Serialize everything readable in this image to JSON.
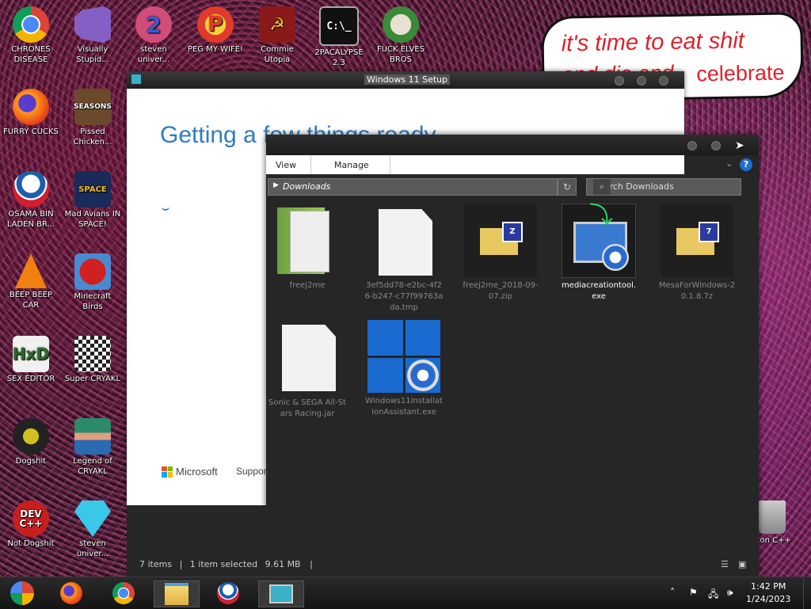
{
  "desktop": {
    "icons": [
      {
        "label": "CHRONES DISEASE",
        "icon": "chrome-icon"
      },
      {
        "label": "Visually Stupid...",
        "icon": "visual-studio-icon"
      },
      {
        "label": "steven univer...",
        "icon": "steven-universe-icon"
      },
      {
        "label": "PEG MY WIFE!",
        "icon": "pegglel-icon"
      },
      {
        "label": "Commie Utopia",
        "icon": "soviet-icon"
      },
      {
        "label": "2PACALYPSE 2.3",
        "icon": "terminal-icon"
      },
      {
        "label": "FUCK ELVES BROS",
        "icon": "elf-icon"
      },
      {
        "label": "FURRY CUCKS",
        "icon": "firefox-icon"
      },
      {
        "label": "Pissed Chicken...",
        "icon": "angry-birds-seasons-icon"
      },
      {
        "label": "OSAMA BIN LADEN BR...",
        "icon": "obama-logo-icon"
      },
      {
        "label": "Mad Avians IN SPACE!",
        "icon": "angry-birds-space-icon"
      },
      {
        "label": "BEEP BEEP CAR",
        "icon": "vlc-icon"
      },
      {
        "label": "Minecraft Birds",
        "icon": "angry-birds-icon"
      },
      {
        "label": "SEX EDITOR",
        "icon": "hxd-icon"
      },
      {
        "label": "Super CRYAKL",
        "icon": "pixel-character-icon"
      },
      {
        "label": "Dogshit",
        "icon": "codeblocks-icon"
      },
      {
        "label": "Legend of CRYAKL",
        "icon": "pixel-hero-icon"
      },
      {
        "label": "Not Dogshit",
        "icon": "devcpp-icon"
      },
      {
        "label": "steven univer...",
        "icon": "diamond-icon"
      },
      {
        "label": "Icon C++",
        "icon": "recycle-bin-icon"
      }
    ],
    "speech_bubble": {
      "line1": "it's time to eat shit",
      "line2": "and die and",
      "overlay": "celebrate"
    }
  },
  "setup_window": {
    "title": "Windows 11 Setup",
    "heading": "Getting a few things ready",
    "brand": "Microsoft",
    "support": "Suppor"
  },
  "explorer": {
    "ribbon": {
      "view": "View",
      "manage": "Manage"
    },
    "address": "Downloads",
    "search_placeholder": "Search Downloads",
    "help": "?",
    "files": [
      {
        "name": "freej2me",
        "kind": "folder"
      },
      {
        "name": "3ef5dd78-e2bc-4f26-b247-c77f99763ada.tmp",
        "kind": "blank"
      },
      {
        "name": "freej2me_2018-09-07.zip",
        "kind": "zip"
      },
      {
        "name": "mediacreationtool.exe",
        "kind": "installer",
        "selected": true
      },
      {
        "name": "MesaForWindows-20.1.8.7z",
        "kind": "7z"
      },
      {
        "name": "Sonic & SEGA All-Stars Racing.jar",
        "kind": "blank"
      },
      {
        "name": "Windows11InstallationAssistant.exe",
        "kind": "win11"
      }
    ],
    "status": {
      "items": "7 items",
      "selected": "1 item selected",
      "size": "9.61 MB"
    }
  },
  "taskbar": {
    "time": "1:42 PM",
    "date": "1/24/2023",
    "apps": [
      "start-icon",
      "firefox-icon",
      "chrome-icon",
      "file-explorer-icon",
      "obama-logo-icon",
      "windows-setup-icon"
    ]
  },
  "colors": {
    "accent": "#2f7cc1",
    "bubble_text": "#e0202a",
    "taskbar": "#1a1a1a"
  }
}
